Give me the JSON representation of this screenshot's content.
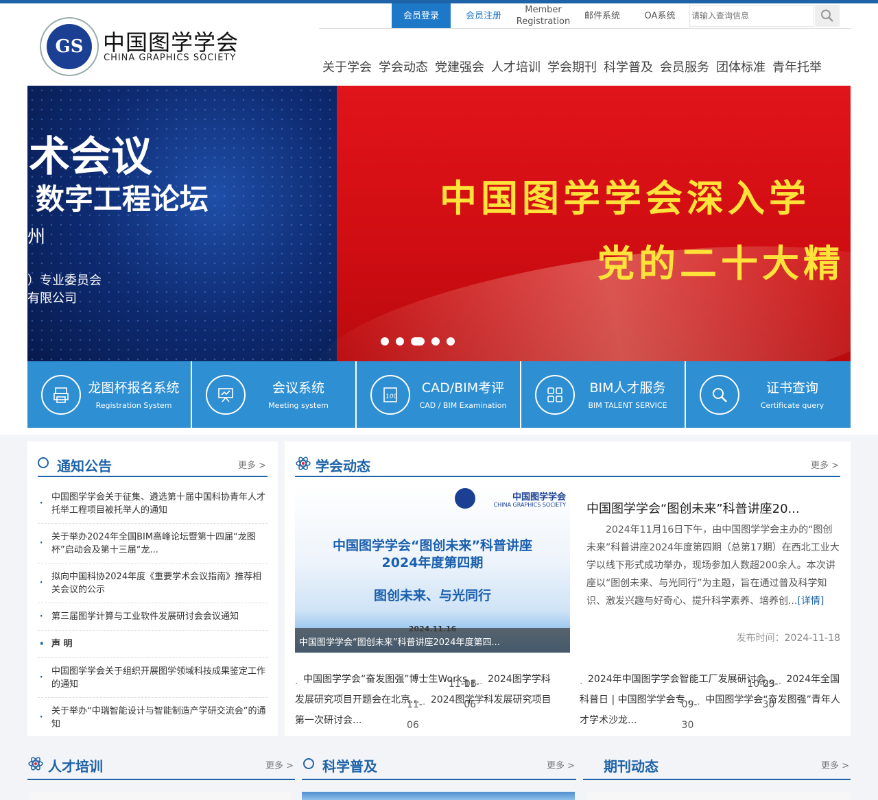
{
  "logo": {
    "mark": "GS",
    "cn": "中国图学学会",
    "en": "CHINA GRAPHICS SOCIETY"
  },
  "toplinks": {
    "login": "会员登录",
    "register": "会员注册",
    "member_reg_1": "Member",
    "member_reg_2": "Registration",
    "mail": "邮件系统",
    "oa": "OA系统",
    "search_placeholder": "请输入查询信息"
  },
  "nav": [
    "关于学会",
    "学会动态",
    "党建强会",
    "人才培训",
    "学会期刊",
    "科学普及",
    "会员服务",
    "团体标准",
    "青年托举"
  ],
  "banner": {
    "left_line1": "术会议",
    "left_line2": "数字工程论坛",
    "left_line3": "州",
    "left_line4": "）专业委员会",
    "left_line5": "有限公司",
    "right_line1": "中国图学学会深入学",
    "right_line2": "党的二十大精"
  },
  "services": [
    {
      "title": "龙图杯报名系统",
      "sub": "Registration System",
      "icon": "printer-icon"
    },
    {
      "title": "会议系统",
      "sub": "Meeting system",
      "icon": "presentation-icon"
    },
    {
      "title": "CAD/BIM考评",
      "sub": "CAD / BIM Examination",
      "icon": "score-paper-icon"
    },
    {
      "title": "BIM人才服务",
      "sub": "BIM TALENT SERVICE",
      "icon": "grid-icon"
    },
    {
      "title": "证书查询",
      "sub": "Certificate query",
      "icon": "magnifier-icon"
    }
  ],
  "notice": {
    "title": "通知公告",
    "more": "更多 >",
    "items": [
      "中国图学学会关于征集、遴选第十届中国科协青年人才托举工程项目被托举人的通知",
      "关于举办2024年全国BIM高峰论坛暨第十四届“龙图杯”启动会及第十三届“龙...",
      "拟向中国科协2024年度《重要学术会议指南》推荐相关会议的公示",
      "第三届图学计算与工业软件发展研讨会会议通知",
      "声 明",
      "中国图学学会关于组织开展图学领域科技成果鉴定工作的通知",
      "关于举办“中瑞智能设计与智能制造产学研交流会”的通知"
    ]
  },
  "news": {
    "title": "学会动态",
    "more": "更多 >",
    "image": {
      "logo_cn": "中国图学学会",
      "logo_en": "CHINA GRAPHICS SOCIETY",
      "line1": "中国图学学会“图创未来”科普讲座",
      "line2": "2024年度第四期",
      "line3": "图创未来、与光同行",
      "date": "2024.11.16",
      "caption": "中国图学学会“图创未来”科普讲座2024年度第四..."
    },
    "headline": "中国图学学会“图创未来”科普讲座20...",
    "summary": "2024年11月16日下午，由中国图学学会主办的“图创未来”科普讲座2024年度第四期（总第17期）在西北工业大学以线下形式成功举办，现场参加人数超200余人。本次讲座以“图创未来、与光同行”为主题，旨在通过普及科学知识、激发兴趣与好奇心、提升科学素养、培养创...",
    "detail": "[详情]",
    "date_label": "发布时间：",
    "date_value": "2024-11-18",
    "list_left": [
      {
        "title": "中国图学学会“奋发图强”博士生Works...",
        "date": "11-06"
      },
      {
        "title": "2024图学学科发展研究项目开题会在北京...",
        "date": "11-06"
      },
      {
        "title": "2024图学学科发展研究项目第一次研讨会...",
        "date": "11-06"
      }
    ],
    "list_right": [
      {
        "title": "2024年中国图学学会智能工厂发展研讨会...",
        "date": "10-23"
      },
      {
        "title": "2024年全国科普日 | 中国图学学会专...",
        "date": "09-30"
      },
      {
        "title": "中国图学学会“奋发图强”青年人才学术沙龙...",
        "date": "09-30"
      }
    ]
  },
  "bottom": {
    "talent": {
      "title": "人才培训",
      "more": "更多 >"
    },
    "science": {
      "title": "科学普及",
      "more": "更多 >"
    },
    "journal": {
      "title": "期刊动态",
      "more": "更多 >"
    }
  }
}
